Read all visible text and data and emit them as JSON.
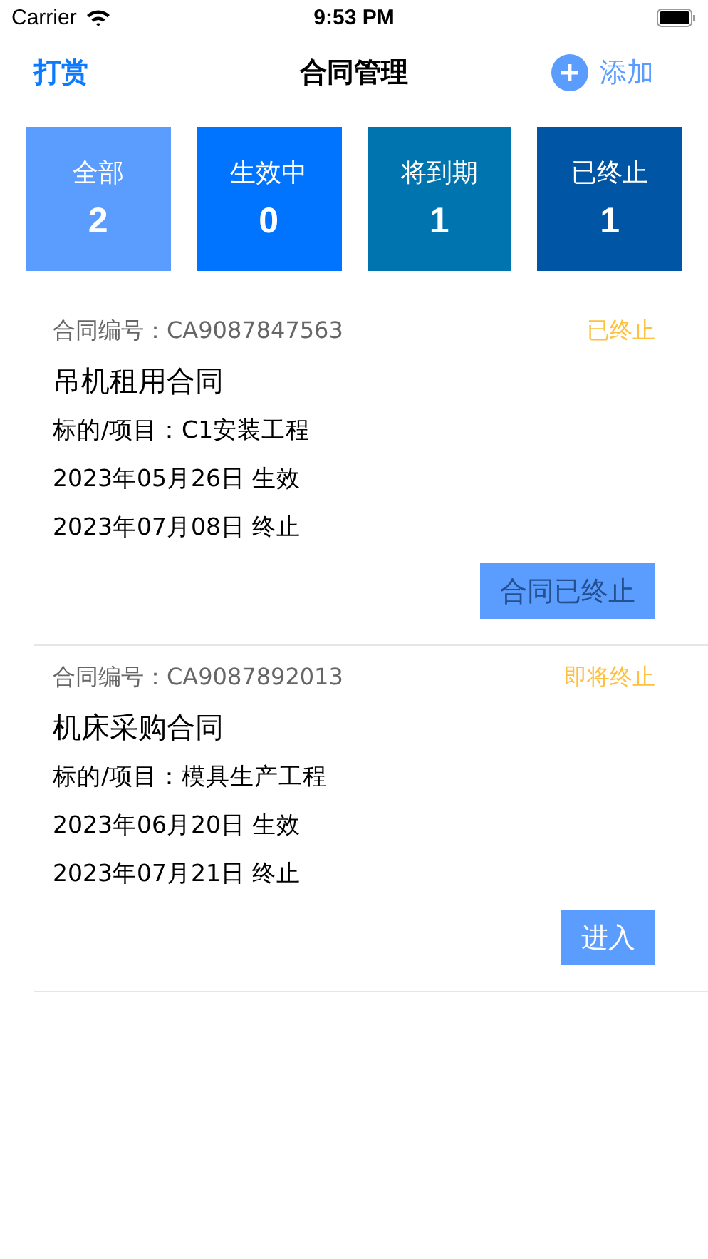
{
  "status_bar": {
    "carrier": "Carrier",
    "time": "9:53 PM"
  },
  "nav": {
    "left": "打赏",
    "title": "合同管理",
    "right": "添加"
  },
  "stats": [
    {
      "label": "全部",
      "count": "2",
      "color": "#5b9dff"
    },
    {
      "label": "生效中",
      "count": "0",
      "color": "#0074ff"
    },
    {
      "label": "将到期",
      "count": "1",
      "color": "#0074ae"
    },
    {
      "label": "已终止",
      "count": "1",
      "color": "#0055a5"
    }
  ],
  "contracts": [
    {
      "number": "合同编号：CA9087847563",
      "status": "已终止",
      "title": "吊机租用合同",
      "project": "标的/项目：C1安装工程",
      "start": "2023年05月26日 生效",
      "end": "2023年07月08日 终止",
      "action": "合同已终止",
      "disabled": true
    },
    {
      "number": "合同编号：CA9087892013",
      "status": "即将终止",
      "title": "机床采购合同",
      "project": "标的/项目：模具生产工程",
      "start": "2023年06月20日 生效",
      "end": "2023年07月21日 终止",
      "action": "进入",
      "disabled": false
    }
  ]
}
